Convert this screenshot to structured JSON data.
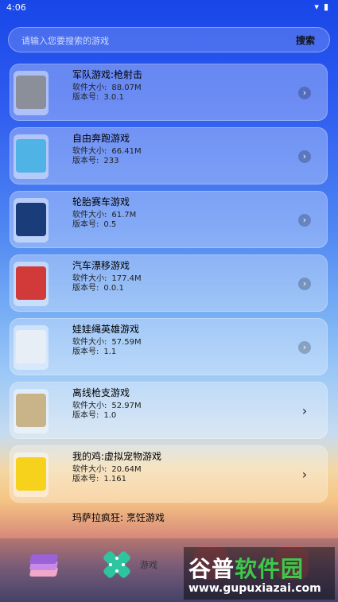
{
  "status": {
    "time": "4:06",
    "wifi_icon": "wifi-icon",
    "battery_icon": "battery-icon"
  },
  "search": {
    "placeholder": "请输入您要搜索的游戏",
    "button": "搜索"
  },
  "games": [
    {
      "title": "军队游戏:枪射击",
      "size_label": "软件大小:",
      "size": "88.07M",
      "version_label": "版本号:",
      "version": "3.0.1",
      "thumb_color": "#8a8f99"
    },
    {
      "title": "自由奔跑游戏",
      "size_label": "软件大小:",
      "size": "66.41M",
      "version_label": "版本号:",
      "version": "233",
      "thumb_color": "#4fb3e6"
    },
    {
      "title": "轮胎赛车游戏",
      "size_label": "软件大小:",
      "size": "61.7M",
      "version_label": "版本号:",
      "version": "0.5",
      "thumb_color": "#1a3c78"
    },
    {
      "title": "汽车漂移游戏",
      "size_label": "软件大小:",
      "size": "177.4M",
      "version_label": "版本号:",
      "version": "0.0.1",
      "thumb_color": "#d23a3a"
    },
    {
      "title": "娃娃绳英雄游戏",
      "size_label": "软件大小:",
      "size": "57.59M",
      "version_label": "版本号:",
      "version": "1.1",
      "thumb_color": "#e8eef6"
    },
    {
      "title": "离线枪支游戏",
      "size_label": "软件大小:",
      "size": "52.97M",
      "version_label": "版本号:",
      "version": "1.0",
      "thumb_color": "#c9b48a"
    },
    {
      "title": "我的鸡:虚拟宠物游戏",
      "size_label": "软件大小:",
      "size": "20.64M",
      "version_label": "版本号:",
      "version": "1.161",
      "thumb_color": "#f7d21c"
    }
  ],
  "partial_item": {
    "title": "玛萨拉疯狂: 烹饪游戏"
  },
  "bottom_nav": {
    "game_label": "游戏"
  },
  "watermark": {
    "name_part1": "谷普",
    "name_part2": "软件园",
    "url": "www.gupuxiazai.com"
  }
}
